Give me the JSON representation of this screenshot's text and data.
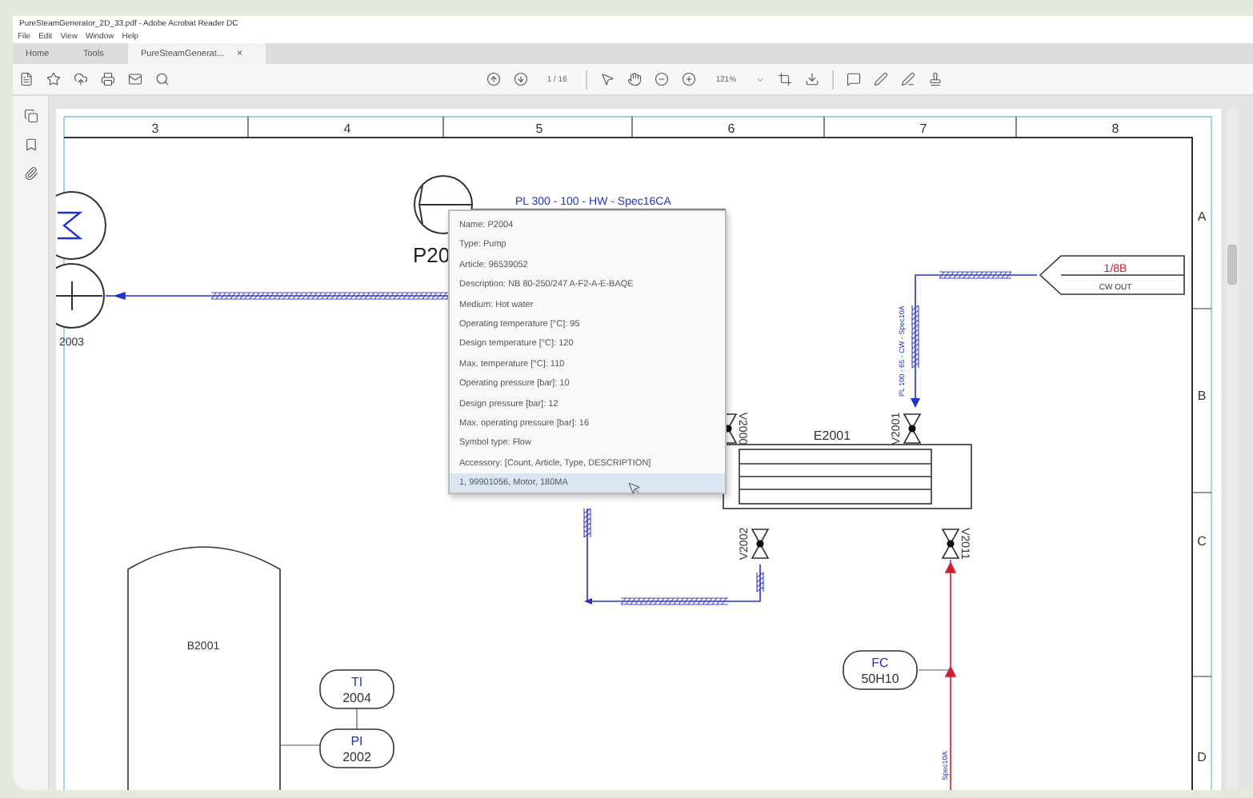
{
  "window": {
    "title": "PureSteamGenerator_2D_33.pdf - Adobe Acrobat Reader DC"
  },
  "menu": [
    "File",
    "Edit",
    "View",
    "Window",
    "Help"
  ],
  "tabs": [
    {
      "label": "Home",
      "selected": false
    },
    {
      "label": "Tools",
      "selected": false
    },
    {
      "label": "PureSteamGenerat...",
      "selected": true,
      "close": "×"
    }
  ],
  "toolbar": {
    "page": "1 / 16",
    "zoom": "121%"
  },
  "drawing": {
    "column_labels": [
      "3",
      "4",
      "5",
      "6",
      "7",
      "8"
    ],
    "row_labels": [
      "A",
      "B",
      "C",
      "D"
    ],
    "pump_left_label": "2003",
    "pump_label": "P20",
    "red_line_label": "PL 300 - 100 - HW - Spec16CA",
    "offpage": {
      "ref": "1/8B",
      "name": "CW OUT"
    },
    "vertical_line_label": "PL 100 - 65 - CW - Spec10A",
    "lower_line_label": "Spec10A",
    "exchanger": "E2001",
    "valves": [
      "V2000",
      "V2001",
      "V2002",
      "V2011"
    ],
    "tank": "B2001",
    "instruments": [
      {
        "tag": "TI",
        "number": "2004"
      },
      {
        "tag": "PI",
        "number": "2002"
      },
      {
        "tag": "FC",
        "number": "50H10"
      }
    ]
  },
  "tooltip": [
    {
      "text": "Name: P2004",
      "selected": false
    },
    {
      "text": "Type: Pump",
      "selected": false
    },
    {
      "text": "Article: 96539052",
      "selected": false
    },
    {
      "text": "Description: NB 80-250/247 A-F2-A-E-BAQE",
      "selected": false
    },
    {
      "text": "Medium: Hot water",
      "selected": false
    },
    {
      "text": "Operating temperature [°C]: 95",
      "selected": false
    },
    {
      "text": "Design temperature [°C]: 120",
      "selected": false
    },
    {
      "text": "Max. temperature [°C]: 110",
      "selected": false
    },
    {
      "text": "Operating pressure [bar]: 10",
      "selected": false
    },
    {
      "text": "Design pressure [bar]: 12",
      "selected": false
    },
    {
      "text": "Max. operating pressure [bar]: 16",
      "selected": false
    },
    {
      "text": "Symbol type: Flow",
      "selected": false
    },
    {
      "text": "Accessory: [Count, Article, Type, DESCRIPTION]",
      "selected": false
    },
    {
      "text": "1, 99901056, Motor, 180MA",
      "selected": true
    }
  ]
}
